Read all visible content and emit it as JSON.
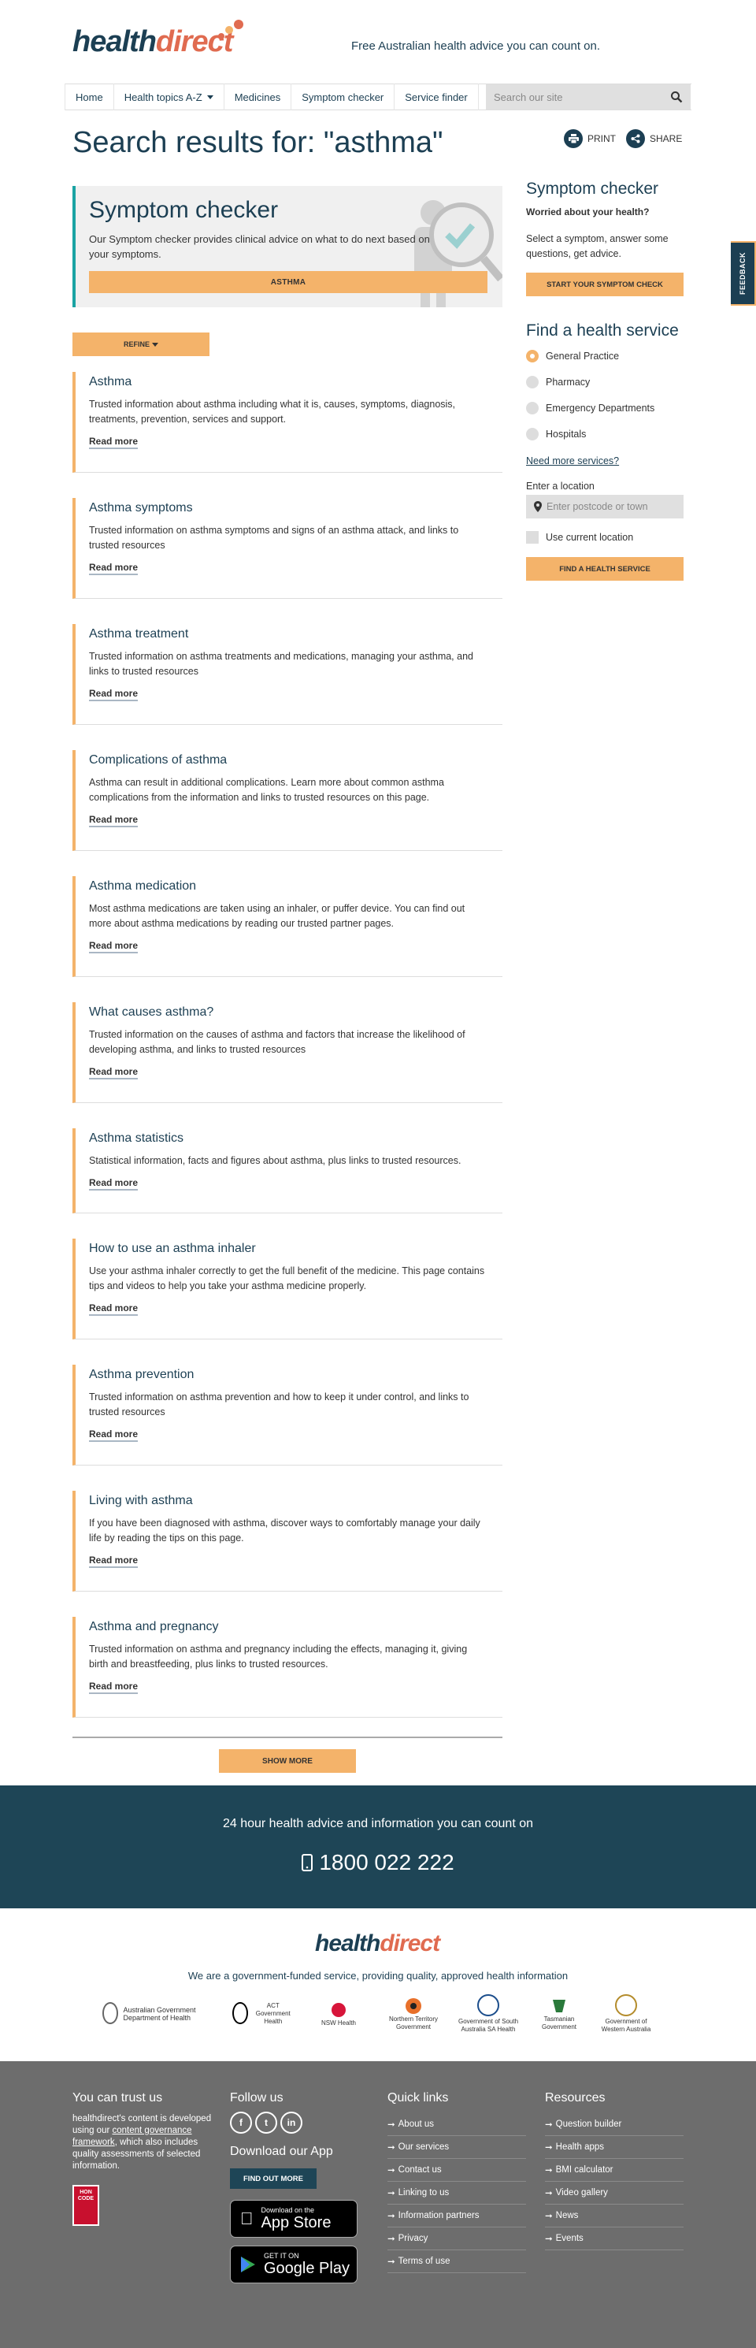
{
  "header": {
    "logo_health": "health",
    "logo_direct": "direct",
    "tagline": "Free Australian health advice you can count on."
  },
  "nav": {
    "items": [
      "Home",
      "Health topics A-Z",
      "Medicines",
      "Symptom checker",
      "Service finder"
    ],
    "search_placeholder": "Search our site"
  },
  "page": {
    "title_prefix": "Search results for:",
    "query": "\"asthma\"",
    "print_label": "PRINT",
    "share_label": "SHARE"
  },
  "banner": {
    "title": "Symptom checker",
    "text": "Our Symptom checker provides clinical advice on what to do next based on your symptoms.",
    "button": "ASTHMA"
  },
  "refine_label": "REFINE",
  "results": [
    {
      "title": "Asthma",
      "desc": "Trusted information about asthma including what it is, causes, symptoms, diagnosis, treatments, prevention, services and support.",
      "link": "Read more"
    },
    {
      "title": "Asthma symptoms",
      "desc": "Trusted information on asthma symptoms and signs of an asthma attack, and links to trusted resources",
      "link": "Read more"
    },
    {
      "title": "Asthma treatment",
      "desc": "Trusted information on asthma treatments and medications, managing your asthma, and links to trusted resources",
      "link": "Read more"
    },
    {
      "title": "Complications of asthma",
      "desc": "Asthma can result in additional complications. Learn more about common asthma complications from the information and links to trusted resources on this page.",
      "link": "Read more"
    },
    {
      "title": "Asthma medication",
      "desc": "Most asthma medications are taken using an inhaler, or puffer device. You can find out more about asthma medications by reading our trusted partner pages.",
      "link": "Read more"
    },
    {
      "title": "What causes asthma?",
      "desc": "Trusted information on the causes of asthma and factors that increase the likelihood of developing asthma, and links to trusted resources",
      "link": "Read more"
    },
    {
      "title": "Asthma statistics",
      "desc": "Statistical information, facts and figures about asthma, plus links to trusted resources.",
      "link": "Read more"
    },
    {
      "title": "How to use an asthma inhaler",
      "desc": "Use your asthma inhaler correctly to get the full benefit of the medicine. This page contains tips and videos to help you take your asthma medicine properly.",
      "link": "Read more"
    },
    {
      "title": "Asthma prevention",
      "desc": "Trusted information on asthma prevention and how to keep it under control, and links to trusted resources",
      "link": "Read more"
    },
    {
      "title": "Living with asthma",
      "desc": "If you have been diagnosed with asthma, discover ways to comfortably manage your daily life by reading the tips on this page.",
      "link": "Read more"
    },
    {
      "title": "Asthma and pregnancy",
      "desc": "Trusted information on asthma and pregnancy including the effects, managing it, giving birth and breastfeeding, plus links to trusted resources.",
      "link": "Read more"
    }
  ],
  "show_more": "SHOW MORE",
  "sidebar": {
    "sc_title": "Symptom checker",
    "sc_subtitle": "Worried about your health?",
    "sc_text": "Select a symptom, answer some questions, get advice.",
    "sc_button": "START YOUR SYMPTOM CHECK",
    "fh_title": "Find a health service",
    "options": [
      "General Practice",
      "Pharmacy",
      "Emergency Departments",
      "Hospitals"
    ],
    "more_services": "Need more services?",
    "location_label": "Enter a location",
    "location_placeholder": "Enter postcode or town",
    "use_current": "Use current location",
    "fh_button": "FIND A HEALTH SERVICE"
  },
  "feedback": "FEEDBACK",
  "band": {
    "text": "24 hour health advice and information you can count on",
    "phone": "1800 022 222"
  },
  "gov": {
    "text": "We are a government-funded service, providing quality, approved health information",
    "logos": [
      "Australian Government Department of Health",
      "ACT Government Health",
      "NSW Health",
      "Northern Territory Government",
      "Government of South Australia SA Health",
      "Tasmanian Government",
      "Government of Western Australia"
    ]
  },
  "footer": {
    "trust_title": "You can trust us",
    "trust_text_1": "healthdirect's content is developed using our ",
    "trust_link": "content governance framework",
    "trust_text_2": ", which also includes quality assessments of selected information.",
    "hon_badge": "HON CODE",
    "follow_title": "Follow us",
    "app_title": "Download our App",
    "find_out_more": "FIND OUT MORE",
    "appstore_small": "Download on the",
    "appstore_big": "App Store",
    "gplay_small": "GET IT ON",
    "gplay_big": "Google Play",
    "quick_title": "Quick links",
    "quick_links": [
      "About us",
      "Our services",
      "Contact us",
      "Linking to us",
      "Information partners",
      "Privacy",
      "Terms of use"
    ],
    "res_title": "Resources",
    "resources": [
      "Question builder",
      "Health apps",
      "BMI calculator",
      "Video gallery",
      "News",
      "Events"
    ]
  },
  "colors": {
    "brand_navy": "#1c3f53",
    "accent_orange": "#f4b36a",
    "teal": "#1aa3a3",
    "logo_coral": "#e06b50"
  }
}
